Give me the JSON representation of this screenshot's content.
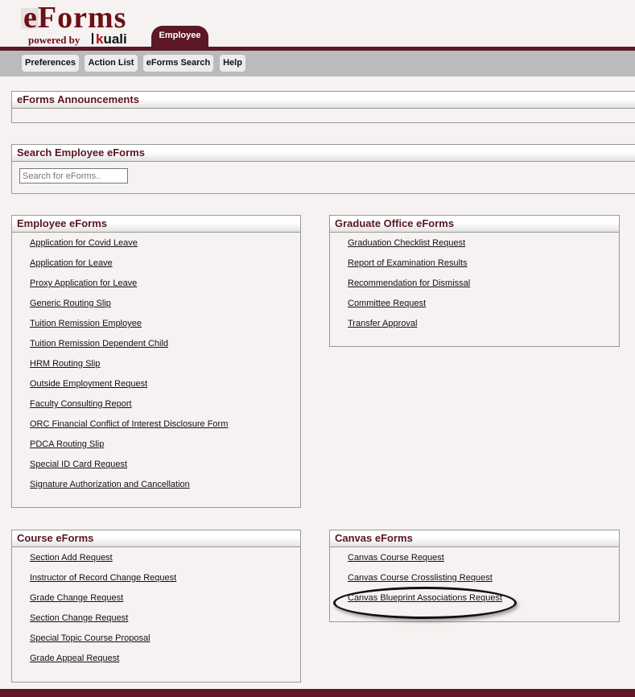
{
  "header": {
    "logo_title": "eForms",
    "logo_powered_by": "powered by",
    "logo_brand": "uali",
    "logo_brand_k": "k",
    "active_tab": "Employee"
  },
  "nav": {
    "buttons": [
      "Preferences",
      "Action List",
      "eForms Search",
      "Help"
    ]
  },
  "announcements": {
    "title": "eForms Announcements"
  },
  "search": {
    "title": "Search Employee eForms",
    "placeholder": "Search for eForms..",
    "value": ""
  },
  "employee_eforms": {
    "title": "Employee eForms",
    "links": [
      "Application for Covid Leave",
      "Application for Leave",
      "Proxy Application for Leave",
      "Generic Routing Slip",
      "Tuition Remission Employee",
      "Tuition Remission Dependent Child",
      "HRM Routing Slip",
      "Outside Employment Request",
      "Faculty Consulting Report",
      "ORC Financial Conflict of Interest Disclosure Form",
      "PDCA Routing Slip",
      "Special ID Card Request",
      "Signature Authorization and Cancellation"
    ]
  },
  "graduate_eforms": {
    "title": "Graduate Office eForms",
    "links": [
      "Graduation Checklist Request",
      "Report of Examination Results",
      "Recommendation for Dismissal",
      "Committee Request",
      "Transfer Approval"
    ]
  },
  "course_eforms": {
    "title": "Course eForms",
    "links": [
      "Section Add Request",
      "Instructor of Record Change Request",
      "Grade Change Request",
      "Section Change Request",
      "Special Topic Course Proposal",
      "Grade Appeal Request"
    ]
  },
  "canvas_eforms": {
    "title": "Canvas eForms",
    "links": [
      "Canvas Course Request",
      "Canvas Course Crosslisting Request",
      "Canvas Blueprint Associations Request"
    ],
    "highlighted": "Canvas Blueprint Associations Request"
  },
  "colors": {
    "brand_maroon": "#5c1826",
    "nav_gray": "#bbbbbb",
    "page_bg": "#f6f2f1"
  }
}
